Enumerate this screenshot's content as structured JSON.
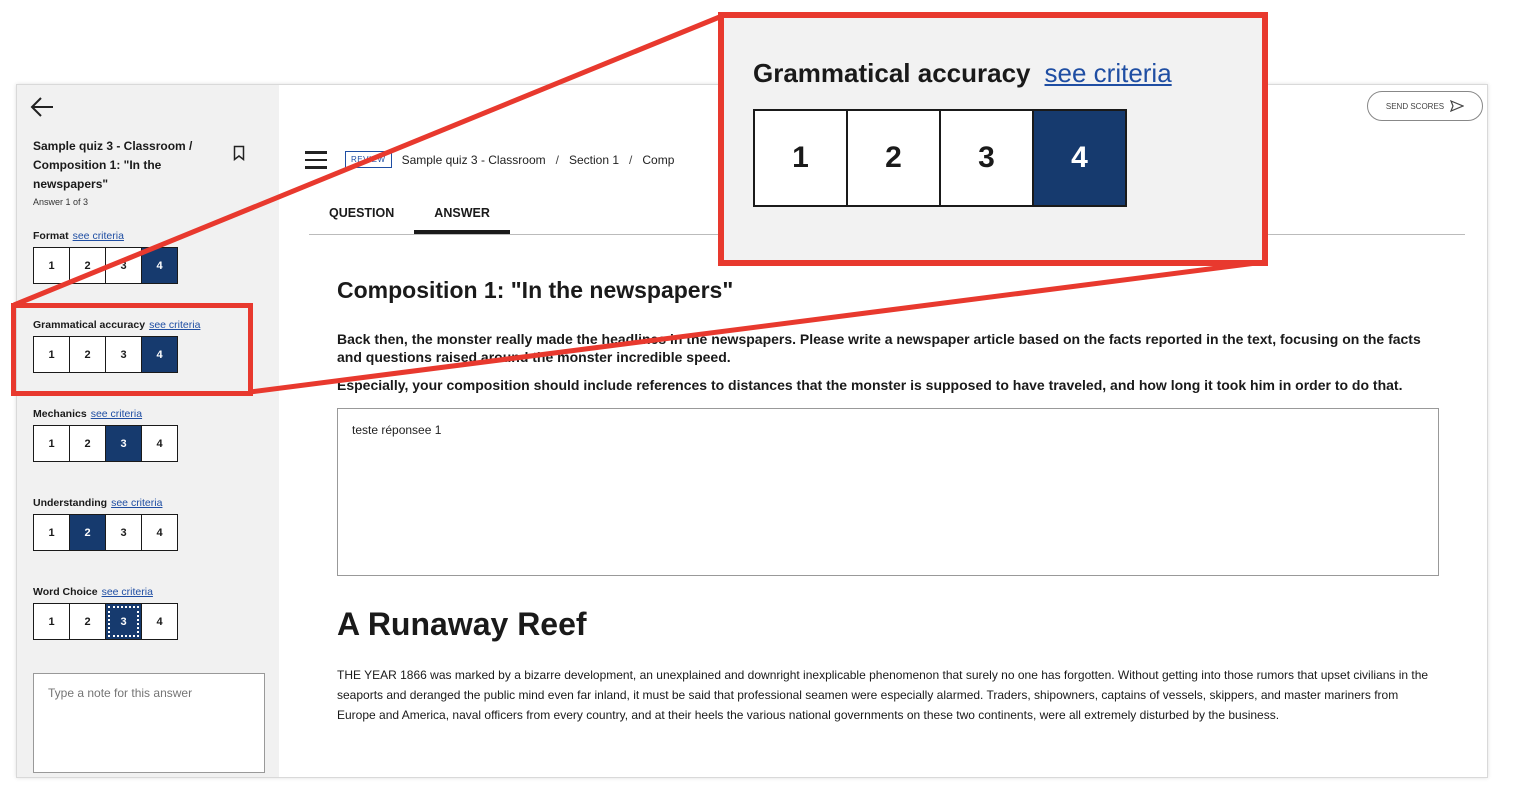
{
  "sidebar": {
    "quiz_title": "Sample quiz 3 - Classroom / Composition 1: \"In the newspapers\"",
    "answer_count": "Answer 1 of 3",
    "see_criteria": "see criteria",
    "criteria": [
      {
        "name": "Format",
        "scores": [
          "1",
          "2",
          "3",
          "4"
        ],
        "selected": 4
      },
      {
        "name": "Grammatical accuracy",
        "scores": [
          "1",
          "2",
          "3",
          "4"
        ],
        "selected": 4
      },
      {
        "name": "Mechanics",
        "scores": [
          "1",
          "2",
          "3",
          "4"
        ],
        "selected": 3
      },
      {
        "name": "Understanding",
        "scores": [
          "1",
          "2",
          "3",
          "4"
        ],
        "selected": 2
      },
      {
        "name": "Word Choice",
        "scores": [
          "1",
          "2",
          "3",
          "4"
        ],
        "selected": 3
      }
    ],
    "note_placeholder": "Type a note for this answer"
  },
  "header": {
    "send_scores": "SEND SCORES",
    "review_badge": "REVIEW",
    "breadcrumb": [
      "Sample quiz 3 - Classroom",
      "Section 1",
      "Comp"
    ]
  },
  "tabs": [
    {
      "label": "QUESTION",
      "active": false
    },
    {
      "label": "ANSWER",
      "active": true
    }
  ],
  "content": {
    "composition_title": "Composition 1: \"In the newspapers\"",
    "prompt_1": "Back then, the monster really made the headlines in the newspapers. Please write a newspaper article based on the facts reported in the text, focusing on the facts and questions raised around the monster incredible speed.",
    "prompt_2": "Especially, your composition should include references to distances that the monster is supposed to have traveled, and how long it took him in order to do that.",
    "answer_text": "teste réponsee 1",
    "reading_title": "A Runaway Reef",
    "reading_text": "THE YEAR 1866 was marked by a bizarre development, an unexplained and downright inexplicable phenomenon that surely no one has forgotten. Without getting into those rumors that upset civilians in the seaports and deranged the public mind even far inland, it must be said that professional seamen were especially alarmed. Traders, shipowners, captains of vessels, skippers, and master mariners from Europe and America, naval officers from every country, and at their heels the various national governments on these two continents, were all extremely disturbed by the business."
  },
  "zoom": {
    "title": "Grammatical accuracy",
    "link": "see criteria",
    "scores": [
      "1",
      "2",
      "3",
      "4"
    ],
    "selected": 4
  },
  "colors": {
    "accent": "#163a6e",
    "link": "#1f4ea3",
    "highlight": "#e8392e"
  }
}
